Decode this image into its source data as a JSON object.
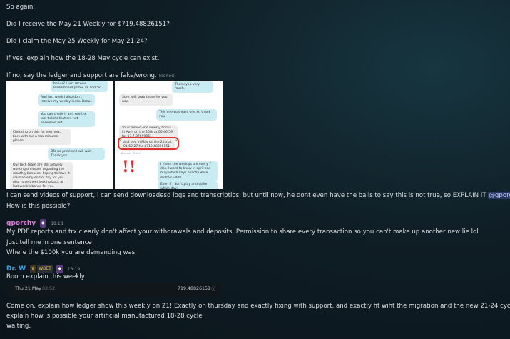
{
  "messages_top": {
    "line1": "So again:",
    "line2": "Did I receive the May 21 Weekly for $719.48826151?",
    "line3": "Did I claim the May 25 Weekly for May 21-24?",
    "line4": "If yes, explain how the 18-28 May cycle can exist.",
    "line5": "If no, say the ledger and support are fake/wrong.",
    "edited": "(edited)"
  },
  "embed": {
    "left": [
      {
        "who": "user",
        "text": "bonus? I just receive leaderboard prizes 1k and 5k"
      },
      {
        "who": "user",
        "text": "And last week I also don't receive my weekly loses. Bonus"
      },
      {
        "who": "user",
        "text": "You can check it and see the last tickets that are not answered yet."
      },
      {
        "who": "agent",
        "text": "Checking on this for you now, bare with me a few minutes please"
      },
      {
        "who": "user",
        "text": "Ofc no problem I will wait. Thank you"
      },
      {
        "who": "agent",
        "text": "Our tech team are still actively working on issues regarding the monthly bonuses, hoping to have it claimable by end of day for you. Also have them looking back at last week's bonus for you."
      }
    ],
    "right": [
      {
        "who": "user",
        "text": "Thank you very much."
      },
      {
        "who": "agent",
        "text": "Sure, will grab those for you now."
      },
      {
        "who": "user",
        "text": "This one was easy one xd thank you"
      },
      {
        "who": "agent",
        "text": "You claimed one weekly bonus in April on the 20th at 00:46:59 for $7.7.37699061"
      },
      {
        "who": "agent",
        "text": "and one in May on the 21st at 01:52:27 for $719.48826151"
      },
      {
        "who": "user",
        "text": "I mean the weeklys are every 7 day. I want to know in april and may which days exactly were able to claim"
      },
      {
        "who": "user",
        "text": "Even if I don't play and claim which days"
      }
    ],
    "sig_right": "Spencer · 2 min",
    "exclaim": "!!"
  },
  "msg1": {
    "line1_pre": "I can  send videos of support, i can send downloadesd logs and transcriptios, but until now, he dont even have the balls to say this is not true, so EXPLAIN IT ",
    "mention": "@gporchy",
    "line2": "How is this possible?"
  },
  "msg2": {
    "user": "gporchy",
    "user_color": "#e07ad9",
    "time": "18:18",
    "line1": "My PDF reports and trx clearly don't affect your withdrawals and deposits. Permission to share every transaction so you can't make up another new lie lol",
    "line2": "Just tell me in one sentence",
    "line3": "Where the $100k you are demanding was"
  },
  "msg3": {
    "user": "Dr. W",
    "user_color": "#3ba3e8",
    "badge": "WBET",
    "time": "18:19",
    "line1": "Boom explain this weekly",
    "txn_date": "Thu 21 May",
    "txn_time": "03:52",
    "txn_amount": "719.48826151"
  },
  "msg4": {
    "line1": "Come on. explain how ledger show this weekly on 21! Exactly on thursday and exactly fixing with support, and exactly fit wiht the migration and the new 21-24 cycle",
    "line2": "explain how is possible your artificial manufactured 18-28 cycle",
    "line3": "waiting."
  }
}
